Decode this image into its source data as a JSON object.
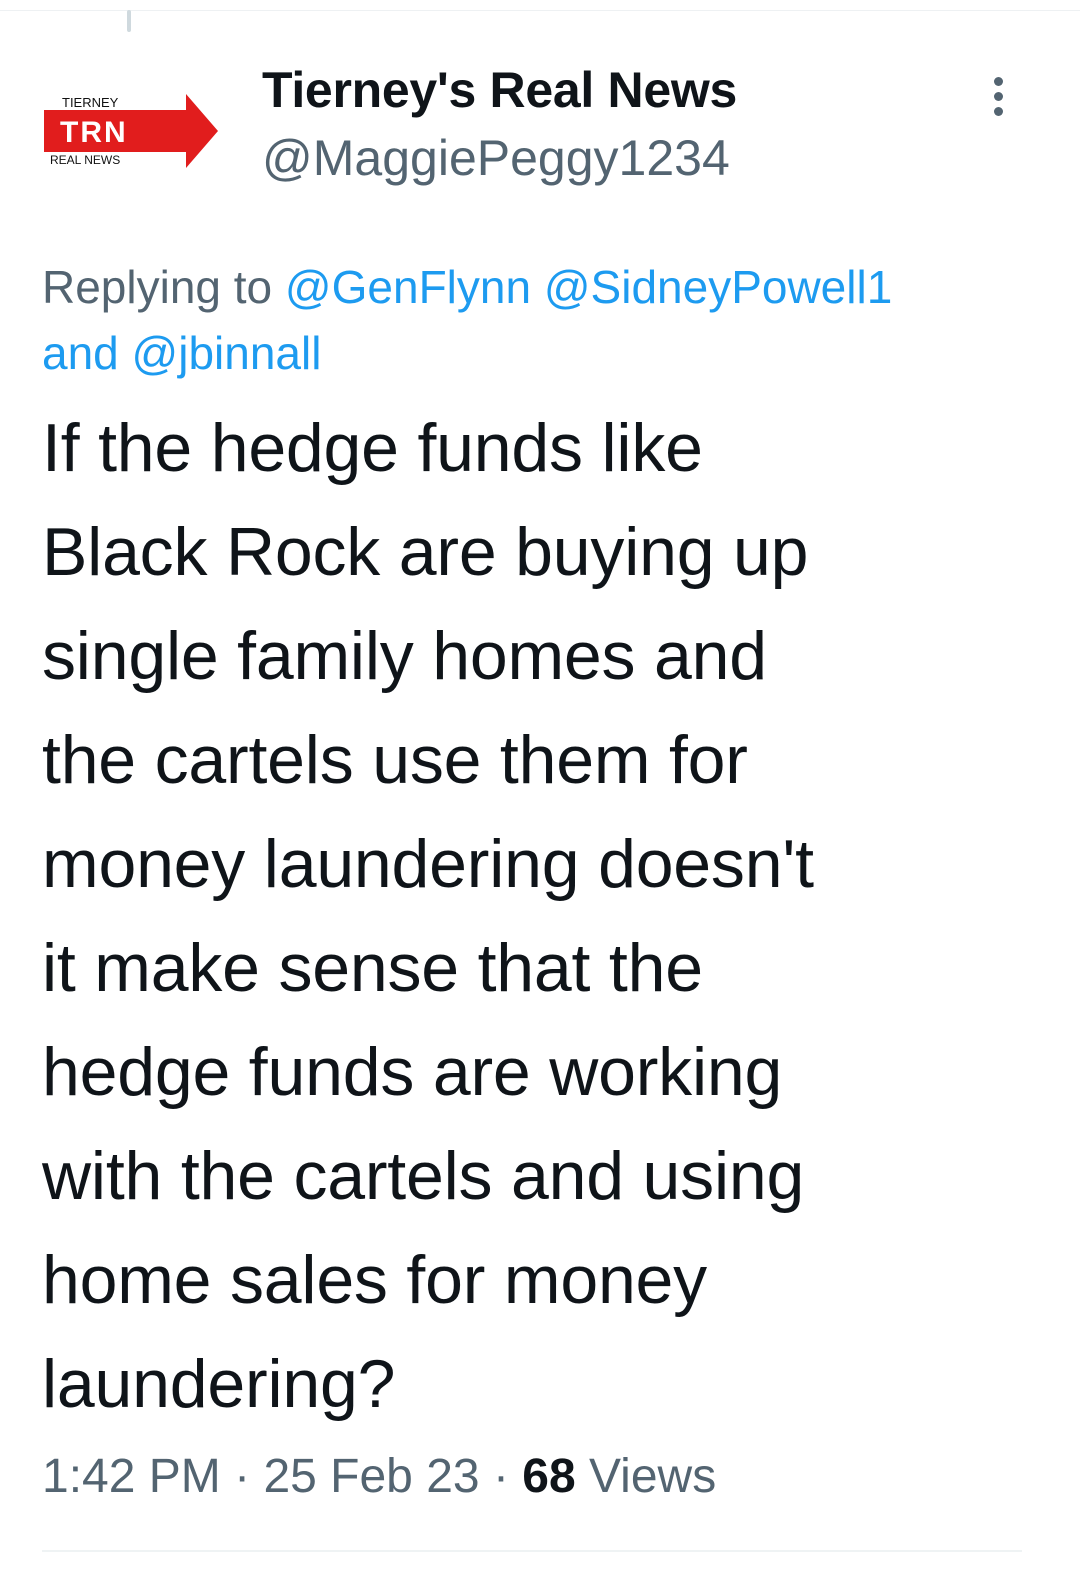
{
  "account": {
    "display_name": "Tierney's Real News",
    "handle": "@MaggiePeggy1234",
    "logo": {
      "top_text": "TIERNEY",
      "main_text": "TRN",
      "bottom_text": "REAL NEWS",
      "brand_color": "#e11d1d"
    }
  },
  "reply_context": {
    "prefix": "Replying to ",
    "mention_1": "@GenFlynn",
    "mention_2": "@SidneyPowell1",
    "conjunction": "and ",
    "mention_3": "@jbinnall"
  },
  "tweet": {
    "lines": [
      "If the hedge funds like",
      "Black Rock are buying up",
      "single family homes and",
      "the cartels use them for",
      "money laundering doesn't",
      "it make sense that the",
      "hedge funds are working",
      "with the cartels and using",
      "home sales for money",
      "laundering?"
    ]
  },
  "meta": {
    "time": "1:42 PM",
    "separator": "·",
    "date": "25 Feb 23",
    "views_count": "68",
    "views_label": "Views"
  },
  "icons": {
    "more": "more-options-icon"
  },
  "colors": {
    "link": "#1d9bf0",
    "secondary_text": "#536471",
    "primary_text": "#0f1419"
  }
}
